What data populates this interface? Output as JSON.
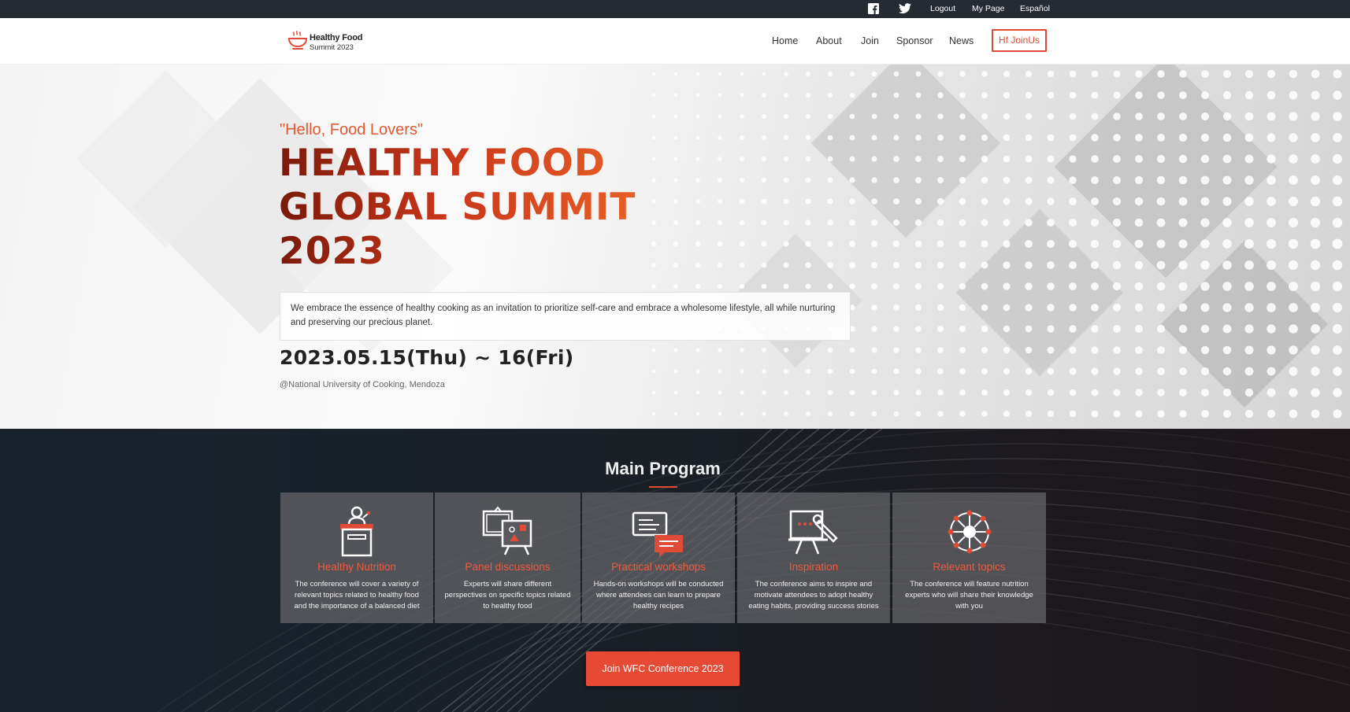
{
  "topbar": {
    "facebook_icon": "facebook-icon",
    "twitter_icon": "twitter-icon",
    "logout": "Logout",
    "mypage": "My Page",
    "language": "Español"
  },
  "header": {
    "logo_line1": "Healthy Food",
    "logo_line2": "Summit 2023",
    "logo_icon": "bowl-icon",
    "nav": {
      "home": "Home",
      "about": "About",
      "join": "Join",
      "sponsor": "Sponsor",
      "news": "News",
      "cta": "Hf JoinUs"
    }
  },
  "hero": {
    "greeting": "\"Hello, Food Lovers\"",
    "title_lines": [
      "HEALTHY FOOD",
      "GLOBAL SUMMIT",
      "2023"
    ],
    "description": "We embrace the essence of healthy cooking as an invitation to prioritize self-care and embrace a wholesome lifestyle, all while nurturing and preserving our precious planet.",
    "date": "2023.05.15(Thu) ~ 16(Fri)",
    "venue": "@National University of Cooking, Mendoza"
  },
  "program": {
    "heading": "Main Program",
    "cards": [
      {
        "icon": "podium-icon",
        "title": "Healthy Nutrition",
        "text": "The conference will cover a variety of relevant topics related to healthy food and the importance of a balanced diet"
      },
      {
        "icon": "presentation-board-icon",
        "title": "Panel discussions",
        "text": "Experts will share different perspectives on specific topics related to healthy food"
      },
      {
        "icon": "chat-bubbles-icon",
        "title": "Practical workshops",
        "text": "Hands-on workshops will be conducted where attendees can learn to prepare healthy recipes"
      },
      {
        "icon": "easel-icon",
        "title": "Inspiration",
        "text": "The conference aims to inspire and motivate attendees to adopt healthy eating habits, providing success stories"
      },
      {
        "icon": "network-icon",
        "title": "Relevant topics",
        "text": "The conference will feature nutrition experts who will share their knowledge with you"
      }
    ],
    "join_button": "Join WFC Conference 2023"
  },
  "colors": {
    "accent": "#e64a35",
    "topbar": "#262a33",
    "program_bg": "#1a1f26"
  }
}
